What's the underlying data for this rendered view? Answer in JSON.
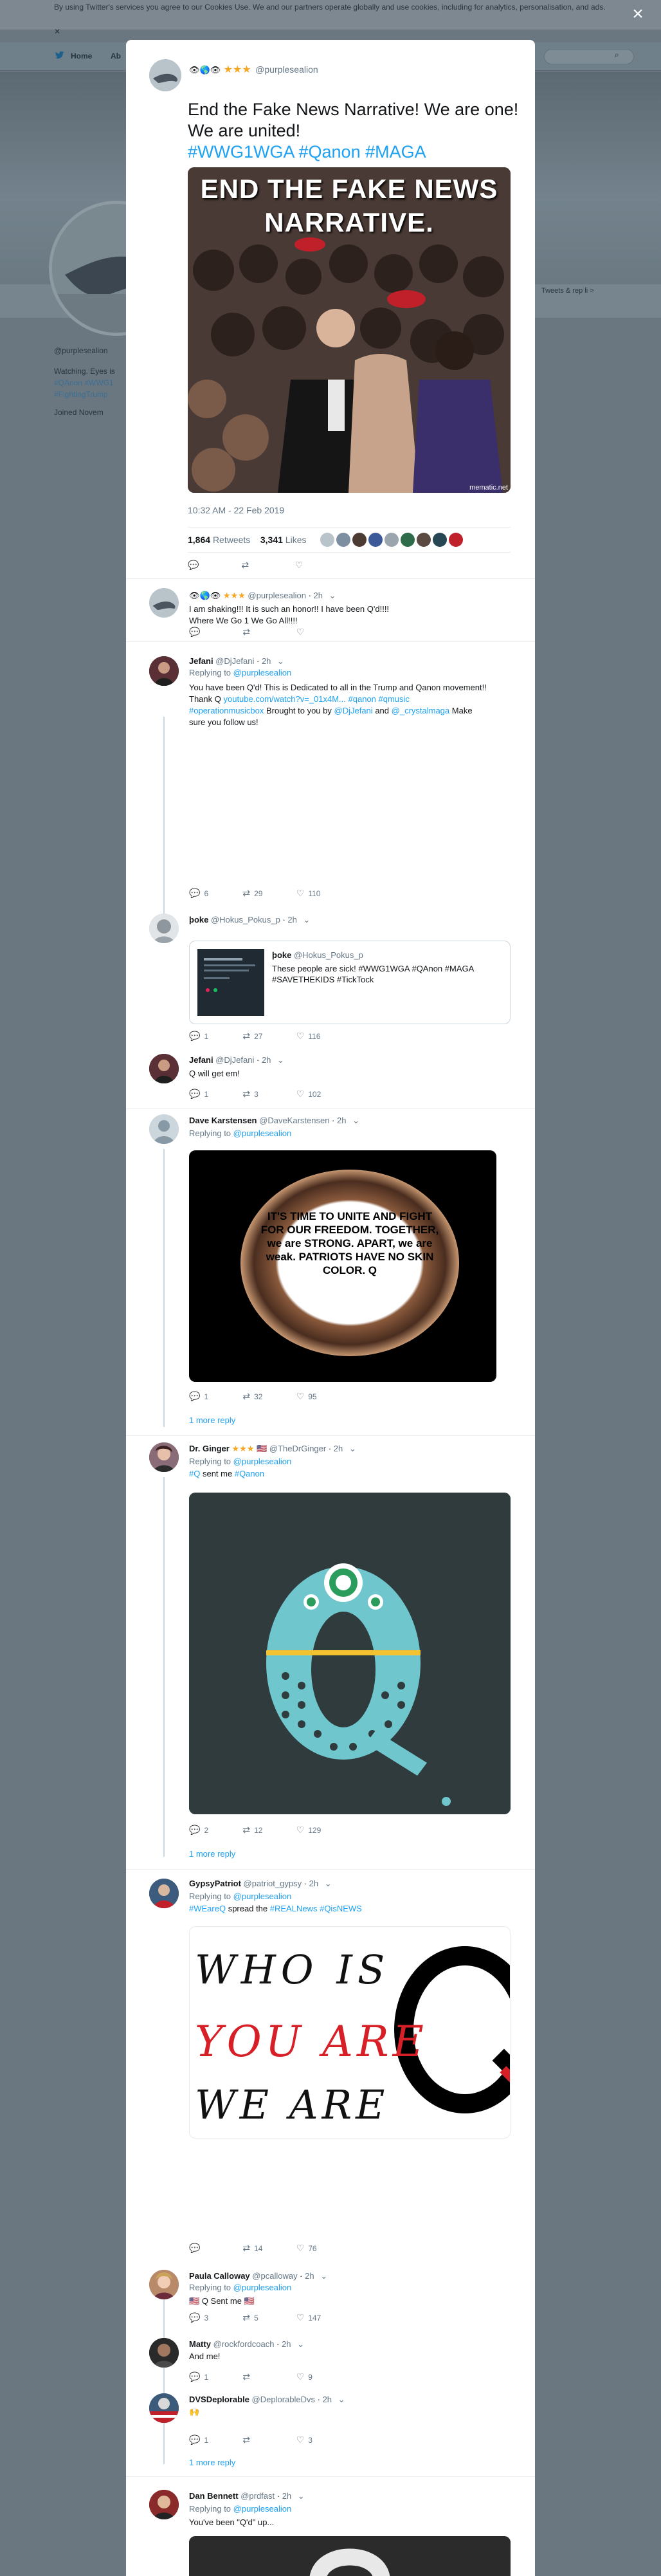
{
  "background": {
    "cookie_text": "By using Twitter's services you agree to our Cookies Use. We and our partners operate globally and use cookies, including for analytics, personalisation, and ads.",
    "nav": {
      "home": "Home",
      "about": "Ab"
    },
    "right_text": "Tweets & rep   li >",
    "profile": {
      "handle": "@purplesealion",
      "bio": "Watching. Eyes is",
      "tags": "#QAnon #WWG1",
      "tags2": "#FightingTrump",
      "joined": "Joined Novem"
    }
  },
  "close_label": "×",
  "main_tweet": {
    "name_stars": "★★★",
    "handle": "@purplesealion",
    "text": "End the Fake News Narrative! We are one! We are united!",
    "hashtags": "#WWG1WGA #Qanon #MAGA",
    "image_caption": "END THE FAKE NEWS NARRATIVE.",
    "image_watermark": "mematic.net",
    "timestamp": "10:32 AM - 22 Feb 2019",
    "retweets_count": "1,864",
    "retweets_label": "Retweets",
    "likes_count": "3,341",
    "likes_label": "Likes"
  },
  "replies": [
    {
      "name": "★★★",
      "handle": "@purplesealion",
      "time": "2h",
      "text": "I am shaking!!! It is such an honor!! I have been Q'd!!!!",
      "text2": "Where We Go 1 We Go All!!!!",
      "replies": "",
      "retweets": "",
      "likes": ""
    },
    {
      "name": "Jefani",
      "handle": "@DjJefani",
      "time": "2h",
      "replying_label": "Replying to",
      "replying_to": "@purplesealion",
      "text_a": "You have been Q'd! This is Dedicated to all in the Trump and Qanon movement!!",
      "text_b": "Thank Q",
      "link": "youtube.com/watch?v=_01x4M...",
      "tags": "#qanon #qmusic",
      "tags2": "#operationmusicbox",
      "brought": "Brought to you by",
      "user1": "@DjJefani",
      "and": "and",
      "user2": "@_crystalmaga",
      "make_sure": "Make",
      "follow": "sure you follow us!",
      "replies": "6",
      "retweets": "29",
      "likes": "110"
    },
    {
      "name": "þoke",
      "handle": "@Hokus_Pokus_p",
      "time": "2h",
      "quote_name": "þoke",
      "quote_handle": "@Hokus_Pokus_p",
      "quote_text": "These people are sick! #WWG1WGA #QAnon #MAGA #SAVETHEKIDS #TickTock",
      "replies": "1",
      "retweets": "27",
      "likes": "116"
    },
    {
      "name": "Jefani",
      "handle": "@DjJefani",
      "time": "2h",
      "text": "Q will get em!",
      "replies": "1",
      "retweets": "3",
      "likes": "102"
    },
    {
      "name": "Dave Karstensen",
      "handle": "@DaveKarstensen",
      "time": "2h",
      "replying_label": "Replying to",
      "replying_to": "@purplesealion",
      "image_text": "IT'S TIME TO UNITE AND FIGHT FOR OUR FREEDOM. TOGETHER, we are STRONG. APART, we are weak. PATRIOTS HAVE NO SKIN COLOR. Q",
      "replies": "1",
      "retweets": "32",
      "likes": "95",
      "more": "1 more reply"
    },
    {
      "name": "Dr. Ginger",
      "name_stars": "★★★",
      "handle": "@TheDrGinger",
      "time": "2h",
      "replying_label": "Replying to",
      "replying_to": "@purplesealion",
      "tag1": "#Q",
      "sent": "sent me",
      "tag2": "#Qanon",
      "replies": "2",
      "retweets": "12",
      "likes": "129",
      "more": "1 more reply"
    },
    {
      "name": "GypsyPatriot",
      "handle": "@patriot_gypsy",
      "time": "2h",
      "replying_label": "Replying to",
      "replying_to": "@purplesealion",
      "tag1": "#WEareQ",
      "spread": "spread the",
      "tag2": "#REALNews",
      "tag3": "#QisNEWS",
      "img_l1": "WHO IS",
      "img_l2": "YOU ARE",
      "img_l3": "WE ARE",
      "replies": "",
      "retweets": "14",
      "likes": "76"
    },
    {
      "name": "Paula Calloway",
      "handle": "@pcalloway",
      "time": "2h",
      "replying_label": "Replying to",
      "replying_to": "@purplesealion",
      "text": "Q Sent me",
      "replies": "3",
      "retweets": "5",
      "likes": "147"
    },
    {
      "name": "Matty",
      "handle": "@rockfordcoach",
      "time": "2h",
      "text": "And me!",
      "replies": "1",
      "retweets": "",
      "likes": "9"
    },
    {
      "name": "DVSDeplorable",
      "handle": "@DeplorableDvs",
      "time": "2h",
      "text": "",
      "replies": "1",
      "retweets": "",
      "likes": "3",
      "more": "1 more reply"
    },
    {
      "name": "Dan Bennett",
      "handle": "@prdfast",
      "time": "2h",
      "replying_label": "Replying to",
      "replying_to": "@purplesealion",
      "text": "You've been \"Q'd\" up..."
    }
  ],
  "colors": {
    "link": "#1da1f2",
    "muted": "#657786",
    "overlay": "#67757f",
    "divider": "#e6ecf0"
  }
}
